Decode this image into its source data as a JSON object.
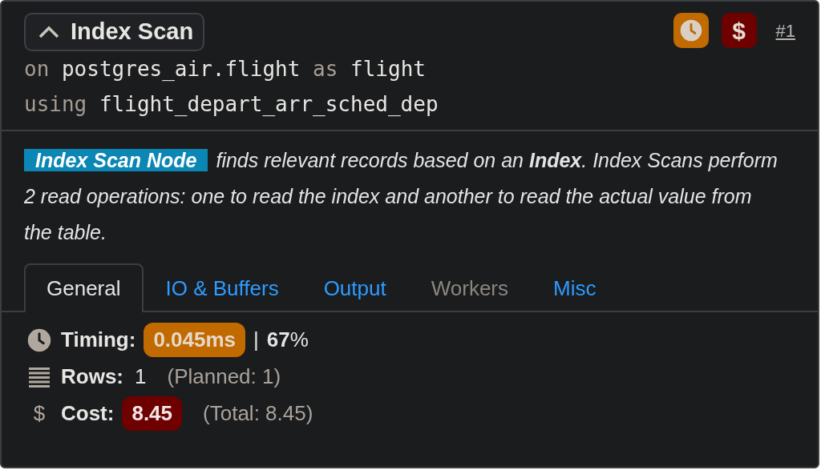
{
  "node": {
    "title": "Index Scan",
    "expanded": true,
    "badges": [
      {
        "kind": "timing",
        "color": "#c06a00"
      },
      {
        "kind": "cost",
        "text": "$",
        "color": "#6e0000"
      }
    ],
    "number_link": "#1",
    "relation": [
      {
        "keyword": "on",
        "value": "postgres_air.flight"
      },
      {
        "keyword": "as",
        "value": "flight"
      }
    ],
    "index_line": {
      "keyword": "using",
      "value": "flight_depart_arr_sched_dep"
    }
  },
  "description": {
    "highlight": "Index Scan Node",
    "text": "finds relevant records based on an **Index**. Index Scans perform 2 read operations: one to read the index and another to read the actual value from the table."
  },
  "tabs": [
    {
      "label": "General",
      "selected": true,
      "disabled": false
    },
    {
      "label": "IO & Buffers",
      "selected": false,
      "disabled": false
    },
    {
      "label": "Output",
      "selected": false,
      "disabled": false
    },
    {
      "label": "Workers",
      "selected": false,
      "disabled": true
    },
    {
      "label": "Misc",
      "selected": false,
      "disabled": false
    }
  ],
  "stats": [
    {
      "kind": "timing",
      "label": "Timing:",
      "badge": "0.045ms",
      "color": "#c06a00",
      "separator": "|",
      "extra": "**67**%"
    },
    {
      "kind": "rows",
      "label": "Rows:",
      "value": "1",
      "extra": "(Planned: 1)"
    },
    {
      "kind": "cost",
      "icon_text": "$",
      "label": "Cost:",
      "badge": "8.45",
      "color": "#6e0000",
      "extra": "(Total: 8.45)"
    }
  ]
}
